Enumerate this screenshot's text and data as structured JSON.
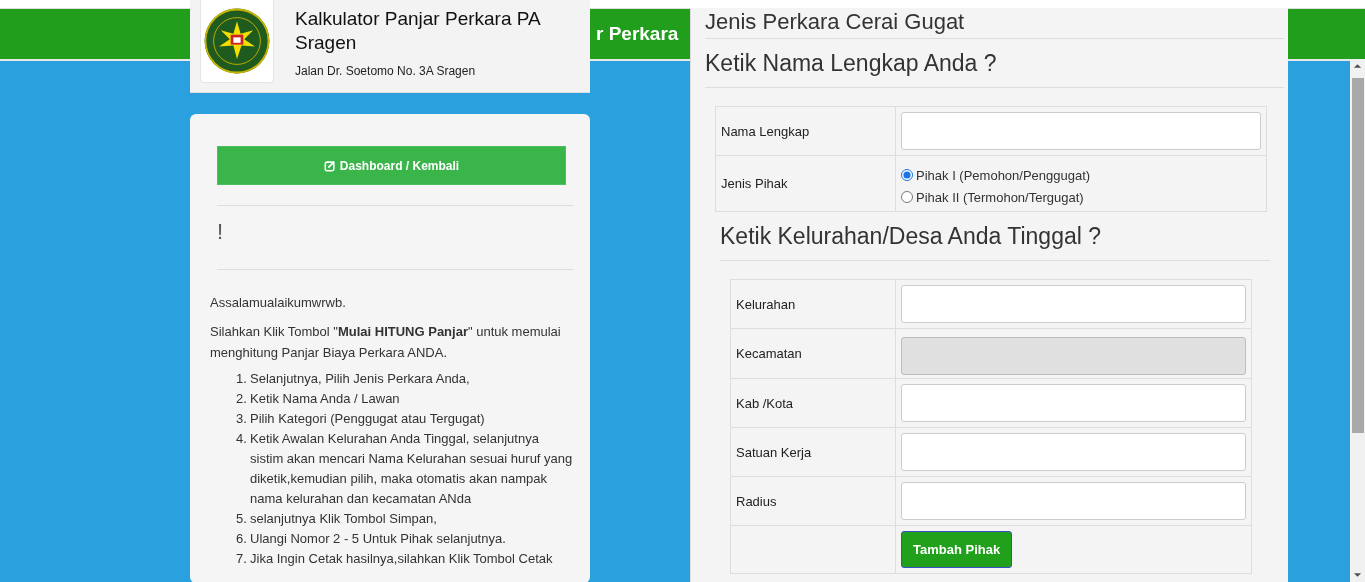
{
  "top_bar": {
    "title": "r Perkara"
  },
  "header": {
    "title": "Kalkulator Panjar Perkara PA Sragen",
    "address": "Jalan Dr. Soetomo No. 3A Sragen"
  },
  "sidebar": {
    "button": "Dashboard / Kembali",
    "notice": "!",
    "greeting": "Assalamualaikumwrwb.",
    "intro": "Silahkan Klik Tombol \"**Mulai HITUNG Panjar**\" untuk memulai menghitung Panjar Biaya Perkara ANDA.",
    "steps": [
      {
        "number": "1.",
        "text": "Selanjutnya, Pilih Jenis Perkara Anda,"
      },
      {
        "number": "2.",
        "text": "Ketik Nama Anda / Lawan"
      },
      {
        "number": "3.",
        "text": "Pilih Kategori (Penggugat atau Tergugat)"
      },
      {
        "number": "4.",
        "text": "Ketik Awalan Kelurahan Anda Tinggal, selanjutnya sistim akan mencari Nama Kelurahan sesuai huruf yang diketik,kemudian pilih, maka otomatis akan nampak nama kelurahan dan kecamatan ANda"
      },
      {
        "number": "5.",
        "text": "selanjutnya Klik Tombol Simpan,"
      },
      {
        "number": "6.",
        "text": "Ulangi Nomor 2 - 5 Untuk Pihak selanjutnya."
      },
      {
        "number": "7.",
        "text": "Jika Ingin Cetak hasilnya,silahkan Klik Tombol Cetak"
      }
    ]
  },
  "modal": {
    "case_heading": "Jenis Perkara Cerai Gugat",
    "name_section": {
      "heading": "Ketik Nama Lengkap Anda ?",
      "rows": [
        {
          "kind": "input",
          "label": "Nama Lengkap",
          "disabled": false
        },
        {
          "kind": "radio",
          "label": "Jenis Pihak",
          "options": [
            {
              "label": "Pihak I (Pemohon/Penggugat)",
              "selected": true
            },
            {
              "label": "Pihak II (Termohon/Tergugat)",
              "selected": false
            }
          ]
        }
      ]
    },
    "address_section": {
      "heading": "Ketik Kelurahan/Desa Anda Tinggal ?",
      "rows": [
        {
          "kind": "input",
          "label": "Kelurahan",
          "disabled": false
        },
        {
          "kind": "input",
          "label": "Kecamatan",
          "disabled": true
        },
        {
          "kind": "input",
          "label": "Kab /Kota",
          "disabled": false
        },
        {
          "kind": "input",
          "label": "Satuan Kerja",
          "disabled": false
        },
        {
          "kind": "input",
          "label": "Radius",
          "disabled": false
        },
        {
          "kind": "button",
          "label": "Tambah Pihak"
        }
      ]
    }
  }
}
